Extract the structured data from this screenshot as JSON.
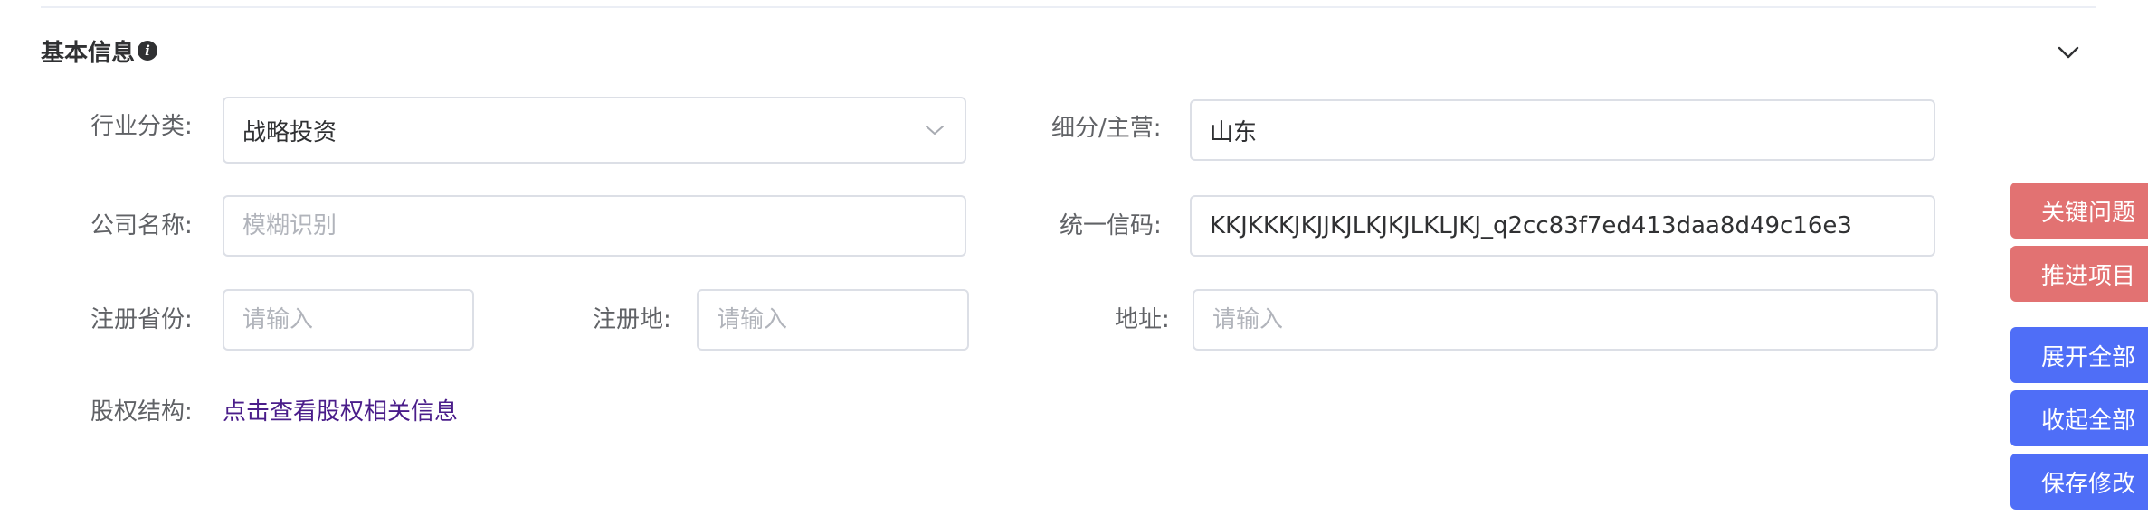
{
  "section": {
    "title": "基本信息",
    "info_icon_glyph": "i"
  },
  "form": {
    "industry": {
      "label": "行业分类:",
      "value": "战略投资"
    },
    "segment": {
      "label": "细分/主营:",
      "value": "山东"
    },
    "company_name": {
      "label": "公司名称:",
      "value": "",
      "placeholder": "模糊识别"
    },
    "credit_code": {
      "label": "统一信码:",
      "value": "KKJKKKJKJJKJLKJKJLKLJKJ_q2cc83f7ed413daa8d49c16e3"
    },
    "reg_province": {
      "label": "注册省份:",
      "value": "",
      "placeholder": "请输入"
    },
    "reg_place": {
      "label": "注册地:",
      "value": "",
      "placeholder": "请输入"
    },
    "address": {
      "label": "地址:",
      "value": "",
      "placeholder": "请输入"
    },
    "equity": {
      "label": "股权结构:",
      "link_text": "点击查看股权相关信息"
    }
  },
  "side_actions": {
    "key_issues": "关键问题",
    "advance_project": "推进项目",
    "expand_all": "展开全部",
    "collapse_all": "收起全部",
    "save_changes": "保存修改"
  },
  "colors": {
    "red_button": "#e27272",
    "blue_button": "#4f6ef7",
    "link": "#4a1d8a"
  }
}
